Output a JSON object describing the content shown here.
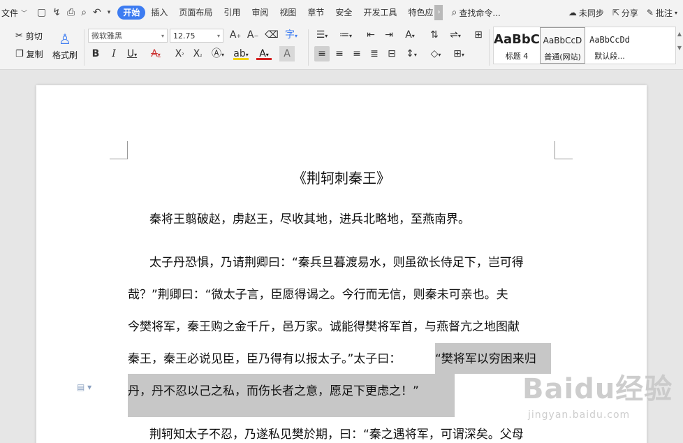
{
  "menubar": {
    "file_label": "文件",
    "tabs": [
      "开始",
      "插入",
      "页面布局",
      "引用",
      "审阅",
      "视图",
      "章节",
      "安全",
      "开发工具",
      "特色应"
    ],
    "active_tab": "开始",
    "search_placeholder": "查找命令...",
    "sync_label": "未同步",
    "share_label": "分享",
    "comment_label": "批注"
  },
  "ribbon": {
    "cut_label": "剪切",
    "copy_label": "复制",
    "format_painter_label": "格式刷",
    "font_name": "微软雅黑",
    "font_size": "12.75",
    "styles": [
      {
        "preview": "AaBbC",
        "label": "标题 4"
      },
      {
        "preview": "AaBbCcD",
        "label": "普通(网站)"
      },
      {
        "preview": "AaBbCcDd",
        "label": "默认段..."
      }
    ],
    "accent_color": "#3d7cf1"
  },
  "document": {
    "title": "《荆轲刺秦王》",
    "lines": [
      "秦将王翦破赵，虏赵王，尽收其地，进兵北略地，至燕南界。",
      "太子丹恐惧，乃请荆卿曰：“秦兵旦暮渡易水，则虽欲长侍足下，岂可得",
      "哉？”荆卿曰：“微太子言，臣愿得谒之。今行而无信，则秦未可亲也。夫",
      "今樊将军，秦王购之金千斤，邑万家。诚能得樊将军首，与燕督亢之地图献",
      "秦王，秦王必说见臣，臣乃得有以报太子。”太子曰：",
      "“樊将军以穷困来归",
      "丹，丹不忍以己之私，而伤长者之意，愿足下更虑之！”",
      "荆轲知太子不忍，乃遂私见樊於期，曰：“秦之遇将军，可谓深矣。父母"
    ],
    "highlight_color": "#c7c7c7"
  },
  "watermark": {
    "brand": "Baidu经验",
    "url": "jingyan.baidu.com"
  }
}
